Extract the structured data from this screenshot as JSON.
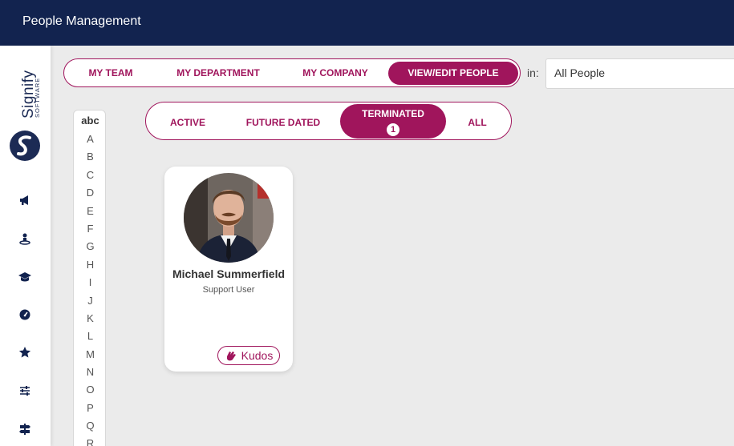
{
  "header": {
    "title": "People Management"
  },
  "logo": {
    "word": "Signify",
    "sub": "SOFTWARE"
  },
  "scope_tabs": [
    {
      "label": "MY TEAM",
      "active": false
    },
    {
      "label": "MY DEPARTMENT",
      "active": false
    },
    {
      "label": "MY COMPANY",
      "active": false
    },
    {
      "label": "VIEW/EDIT PEOPLE",
      "active": true
    }
  ],
  "filter": {
    "in_label": "in:",
    "value": "All People"
  },
  "status_tabs": [
    {
      "label": "ACTIVE",
      "active": false
    },
    {
      "label": "FUTURE DATED",
      "active": false
    },
    {
      "label": "TERMINATED",
      "active": true,
      "count": "1"
    },
    {
      "label": "ALL",
      "active": false
    }
  ],
  "alphabet": {
    "head": "abc",
    "letters": [
      "A",
      "B",
      "C",
      "D",
      "E",
      "F",
      "G",
      "H",
      "I",
      "J",
      "K",
      "L",
      "M",
      "N",
      "O",
      "P",
      "Q",
      "R"
    ]
  },
  "person": {
    "name": "Michael Summerfield",
    "role": "Support User",
    "kudos_label": "Kudos"
  },
  "colors": {
    "brand": "#12234f",
    "accent": "#a0155c"
  },
  "nav_icons": [
    "megaphone-icon",
    "user-location-icon",
    "graduation-cap-icon",
    "gauge-icon",
    "star-icon",
    "sliders-icon",
    "signpost-icon"
  ]
}
